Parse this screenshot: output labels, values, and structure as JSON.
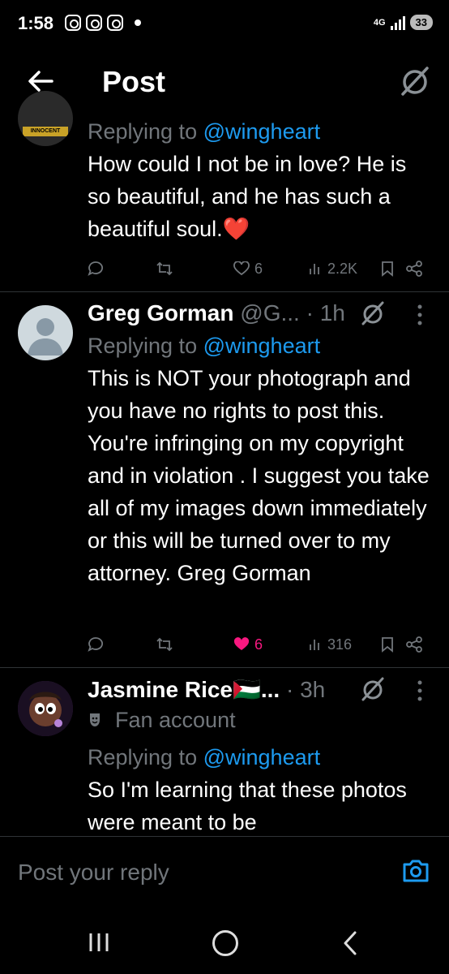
{
  "status_bar": {
    "time": "1:58",
    "network": "4G",
    "battery": "33"
  },
  "header": {
    "title": "Post"
  },
  "tweets": [
    {
      "reply_prefix": "Replying to",
      "reply_handle": "@wingheart",
      "text": "How could I not be in love? He is so beautiful, and he has such a beautiful soul.",
      "emoji": "❤️",
      "avatar_badge": "INNOCENT",
      "likes": "6",
      "views": "2.2K",
      "liked": false
    },
    {
      "name": "Greg Gorman",
      "handle": "@G...",
      "time": "· 1h",
      "reply_prefix": "Replying to",
      "reply_handle": "@wingheart",
      "text": "This is NOT your photograph and you have no rights to post this. You're infringing on my copyright and in violation . I suggest you take all of my images down immediately or this will be turned over to my attorney. Greg Gorman",
      "likes": "6",
      "views": "316",
      "liked": true
    },
    {
      "name": "Jasmine Rice🇵🇸...",
      "time": "· 3h",
      "badge": "Fan account",
      "reply_prefix": "Replying to",
      "reply_handle": "@wingheart",
      "text": "So I'm learning that these photos were meant to be"
    }
  ],
  "reply_bar": {
    "placeholder": "Post your reply"
  },
  "colors": {
    "accent": "#1d9bf0",
    "like": "#f91880",
    "muted": "#71767b",
    "background": "#000000"
  }
}
